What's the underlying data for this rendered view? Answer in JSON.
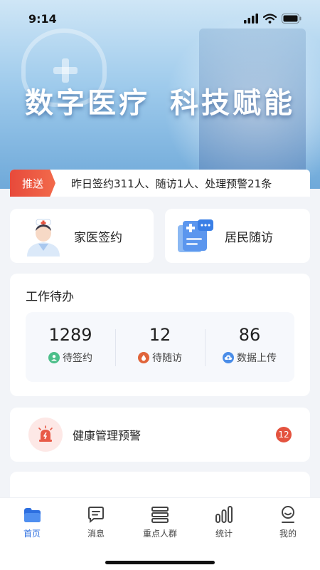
{
  "status_bar": {
    "time": "9:14"
  },
  "banner": {
    "title_left": "数字医疗",
    "title_right": "科技赋能"
  },
  "notice": {
    "tag": "推送",
    "text": "昨日签约311人、随访1人、处理预警21条"
  },
  "quick_actions": [
    {
      "label": "家医签约",
      "icon": "doctor-avatar-icon"
    },
    {
      "label": "居民随访",
      "icon": "followup-document-icon"
    }
  ],
  "todo": {
    "title": "工作待办",
    "items": [
      {
        "value": "1289",
        "label": "待签约",
        "icon": "user-icon",
        "color": "#4cbf8a"
      },
      {
        "value": "12",
        "label": "待随访",
        "icon": "drop-icon",
        "color": "#e0643a"
      },
      {
        "value": "86",
        "label": "数据上传",
        "icon": "cloud-upload-icon",
        "color": "#4a8de8"
      }
    ]
  },
  "alert": {
    "label": "健康管理预警",
    "badge": "12",
    "icon": "siren-icon"
  },
  "tabbar": {
    "active_color": "#2d6fe0",
    "items": [
      {
        "label": "首页",
        "icon": "home-icon",
        "active": true
      },
      {
        "label": "消息",
        "icon": "message-icon",
        "active": false
      },
      {
        "label": "重点人群",
        "icon": "list-icon",
        "active": false
      },
      {
        "label": "统计",
        "icon": "bar-stats-icon",
        "active": false
      },
      {
        "label": "我的",
        "icon": "profile-icon",
        "active": false
      }
    ]
  }
}
